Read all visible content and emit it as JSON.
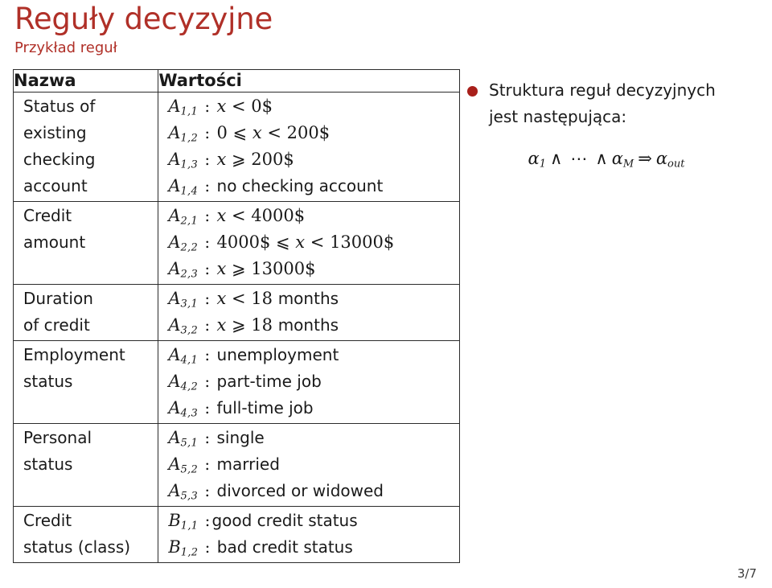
{
  "slide": {
    "title": "Reguły decyzyjne",
    "subtitle": "Przykład reguł",
    "page_number": "3/7",
    "accent_color": "#b03028",
    "bullet_color": "#a81f1a"
  },
  "table": {
    "headers": {
      "name": "Nazwa",
      "values": "Wartości"
    },
    "rows": [
      {
        "name_lines": [
          "Status of",
          "existing",
          "checking",
          "account"
        ],
        "value_lines": [
          {
            "symbol": "A",
            "sub": "1,1",
            "sep": " : ",
            "expr": "x < 0$"
          },
          {
            "symbol": "A",
            "sub": "1,2",
            "sep": " : ",
            "expr": "0 ⩽ x < 200$"
          },
          {
            "symbol": "A",
            "sub": "1,3",
            "sep": " : ",
            "expr": "x ⩾ 200$"
          },
          {
            "symbol": "A",
            "sub": "1,4",
            "sep": " : ",
            "expr": "no checking account"
          }
        ]
      },
      {
        "name_lines": [
          "Credit",
          "amount"
        ],
        "value_lines": [
          {
            "symbol": "A",
            "sub": "2,1",
            "sep": " : ",
            "expr": "x < 4000$"
          },
          {
            "symbol": "A",
            "sub": "2,2",
            "sep": " : ",
            "expr": "4000$ ⩽ x < 13000$"
          },
          {
            "symbol": "A",
            "sub": "2,3",
            "sep": " : ",
            "expr": "x ⩾ 13000$"
          }
        ]
      },
      {
        "name_lines": [
          "Duration",
          "of credit"
        ],
        "value_lines": [
          {
            "symbol": "A",
            "sub": "3,1",
            "sep": " : ",
            "expr": "x < 18 months"
          },
          {
            "symbol": "A",
            "sub": "3,2",
            "sep": " : ",
            "expr": "x ⩾ 18 months"
          }
        ]
      },
      {
        "name_lines": [
          "Employment",
          "status"
        ],
        "value_lines": [
          {
            "symbol": "A",
            "sub": "4,1",
            "sep": " : ",
            "expr": "unemployment"
          },
          {
            "symbol": "A",
            "sub": "4,2",
            "sep": " : ",
            "expr": "part-time job"
          },
          {
            "symbol": "A",
            "sub": "4,3",
            "sep": " : ",
            "expr": "full-time job"
          }
        ]
      },
      {
        "name_lines": [
          "Personal",
          "status"
        ],
        "value_lines": [
          {
            "symbol": "A",
            "sub": "5,1",
            "sep": " : ",
            "expr": "single"
          },
          {
            "symbol": "A",
            "sub": "5,2",
            "sep": " : ",
            "expr": "married"
          },
          {
            "symbol": "A",
            "sub": "5,3",
            "sep": " : ",
            "expr": "divorced or widowed"
          }
        ]
      },
      {
        "name_lines": [
          "Credit",
          "status (class)"
        ],
        "value_lines": [
          {
            "symbol": "B",
            "sub": "1,1",
            "sep": " :",
            "expr": "good credit status"
          },
          {
            "symbol": "B",
            "sub": "1,2",
            "sep": " : ",
            "expr": "bad credit status"
          }
        ]
      }
    ]
  },
  "notes": {
    "bullet_line_1": "Struktura reguł decyzyjnych",
    "bullet_line_2": "jest następująca:",
    "formula": {
      "alpha_1": "α",
      "alpha_1_sub": "1",
      "and_1": "∧",
      "dots": "⋯",
      "and_2": "∧",
      "alpha_m": "α",
      "alpha_m_sub": "M",
      "implies": "⇒",
      "alpha_out": "α",
      "alpha_out_sub": "out"
    }
  }
}
